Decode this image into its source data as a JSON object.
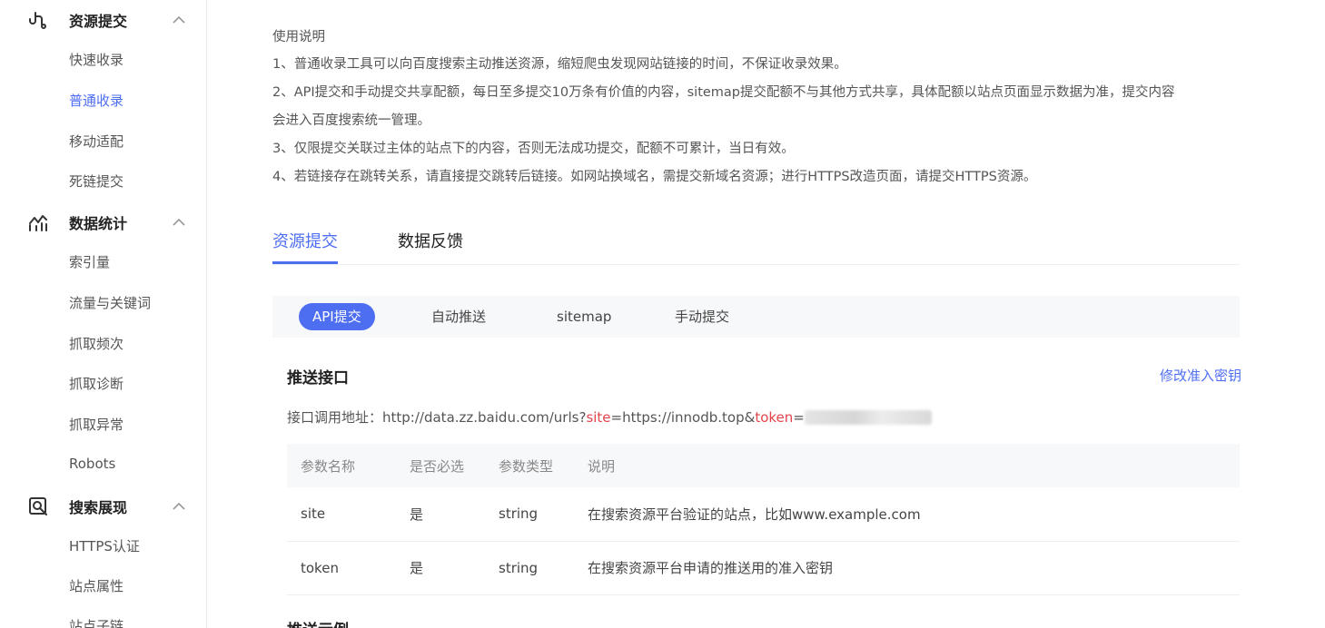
{
  "sidebar": {
    "groups": [
      {
        "title": "资源提交",
        "icon": "link-hook-icon",
        "items": [
          {
            "label": "快速收录",
            "active": false
          },
          {
            "label": "普通收录",
            "active": true
          },
          {
            "label": "移动适配",
            "active": false
          },
          {
            "label": "死链提交",
            "active": false
          }
        ]
      },
      {
        "title": "数据统计",
        "icon": "line-chart-icon",
        "items": [
          {
            "label": "索引量"
          },
          {
            "label": "流量与关键词"
          },
          {
            "label": "抓取频次"
          },
          {
            "label": "抓取诊断"
          },
          {
            "label": "抓取异常"
          },
          {
            "label": "Robots"
          }
        ]
      },
      {
        "title": "搜索展现",
        "icon": "search-box-icon",
        "items": [
          {
            "label": "HTTPS认证"
          },
          {
            "label": "站点属性"
          },
          {
            "label": "站点子链"
          }
        ]
      }
    ]
  },
  "usage": {
    "title": "使用说明",
    "lines": [
      "1、普通收录工具可以向百度搜索主动推送资源，缩短爬虫发现网站链接的时间，不保证收录效果。",
      "2、API提交和手动提交共享配额，每日至多提交10万条有价值的内容，sitemap提交配额不与其他方式共享，具体配额以站点页面显示数据为准，提交内容",
      "会进入百度搜索统一管理。",
      "3、仅限提交关联过主体的站点下的内容，否则无法成功提交，配额不可累计，当日有效。",
      "4、若链接存在跳转关系，请直接提交跳转后链接。如网站换域名，需提交新域名资源；进行HTTPS改造页面，请提交HTTPS资源。"
    ]
  },
  "tabs": {
    "resource_submit": "资源提交",
    "data_feedback": "数据反馈"
  },
  "subtabs": {
    "api": "API提交",
    "auto": "自动推送",
    "sitemap": "sitemap",
    "manual": "手动提交"
  },
  "push": {
    "title": "推送接口",
    "modify_link": "修改准入密钥",
    "endpoint_label": "接口调用地址：",
    "url_base": "http://data.zz.baidu.com/urls?",
    "param_site": "site",
    "site_value": "=https://innodb.top&",
    "param_token": "token",
    "eq": "="
  },
  "params_table": {
    "headers": [
      "参数名称",
      "是否必选",
      "参数类型",
      "说明"
    ],
    "rows": [
      [
        "site",
        "是",
        "string",
        "在搜索资源平台验证的站点，比如www.example.com"
      ],
      [
        "token",
        "是",
        "string",
        "在搜索资源平台申请的推送用的准入密钥"
      ]
    ]
  },
  "example": {
    "title": "推送示例"
  },
  "colors": {
    "accent": "#4e6ef2",
    "param_red": "#e4434b"
  }
}
